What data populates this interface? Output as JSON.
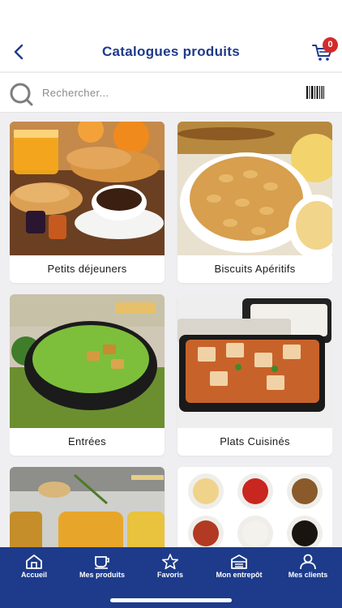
{
  "header": {
    "title": "Catalogues produits",
    "cart_count": "0"
  },
  "search": {
    "placeholder": "Rechercher..."
  },
  "catalog": [
    {
      "label": "Petits déjeuners",
      "image": "breakfast-photo"
    },
    {
      "label": "Biscuits Apéritifs",
      "image": "snacks-photo"
    },
    {
      "label": "Entrées",
      "image": "soup-photo"
    },
    {
      "label": "Plats Cuisinés",
      "image": "prepared-meals-photo"
    },
    {
      "label": "",
      "image": "broths-photo"
    },
    {
      "label": "",
      "image": "sauces-photo"
    }
  ],
  "tabbar": {
    "tabs": [
      {
        "label": "Accueil",
        "icon": "home-icon"
      },
      {
        "label": "Mes produits",
        "icon": "cup-icon"
      },
      {
        "label": "Favoris",
        "icon": "star-icon"
      },
      {
        "label": "Mon entrepôt",
        "icon": "warehouse-icon"
      },
      {
        "label": "Mes clients",
        "icon": "user-icon"
      }
    ]
  },
  "colors": {
    "primary": "#1d3b8a",
    "title": "#1e3a8a",
    "badge": "#d42a2a",
    "background": "#efeff1"
  }
}
